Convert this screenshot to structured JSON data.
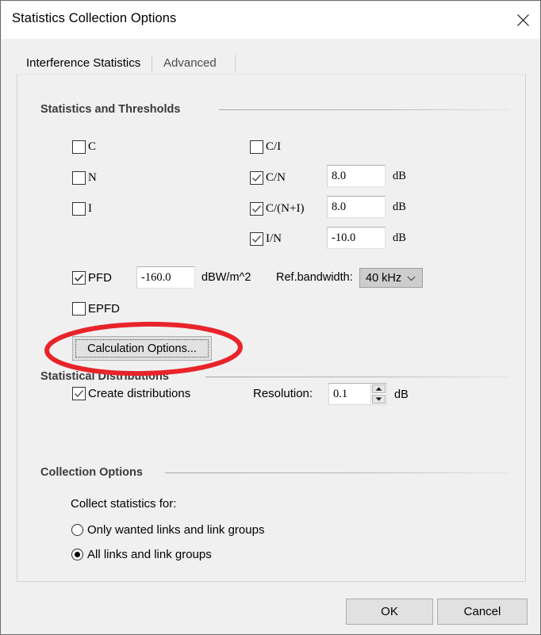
{
  "window": {
    "title": "Statistics Collection Options",
    "close_icon": "close-icon"
  },
  "tabs": [
    {
      "label": "Interference Statistics",
      "selected": true
    },
    {
      "label": "Advanced",
      "selected": false
    }
  ],
  "groups": {
    "thresholds": {
      "title": "Statistics and Thresholds"
    },
    "distributions": {
      "title": "Statistical Distributions"
    },
    "collection": {
      "title": "Collection Options"
    }
  },
  "checkboxes": {
    "c": {
      "label": "C",
      "checked": false
    },
    "n": {
      "label": "N",
      "checked": false
    },
    "i": {
      "label": "I",
      "checked": false
    },
    "ci": {
      "label": "C/I",
      "checked": false
    },
    "cn": {
      "label": "C/N",
      "checked": true
    },
    "cni": {
      "label": "C/(N+I)",
      "checked": true
    },
    "in": {
      "label": "I/N",
      "checked": true
    },
    "pfd": {
      "label": "PFD",
      "checked": true
    },
    "epfd": {
      "label": "EPFD",
      "checked": false
    },
    "create_distributions": {
      "label": "Create distributions",
      "checked": true
    }
  },
  "fields": {
    "cn_threshold": {
      "value": "8.0",
      "unit": "dB"
    },
    "cni_threshold": {
      "value": "8.0",
      "unit": "dB"
    },
    "in_threshold": {
      "value": "-10.0",
      "unit": "dB"
    },
    "pfd_threshold": {
      "value": "-160.0",
      "unit": "dBW/m^2"
    },
    "resolution": {
      "value": "0.1",
      "unit": "dB",
      "label": "Resolution:"
    }
  },
  "ref_bandwidth": {
    "label": "Ref.bandwidth:",
    "selected": "40 kHz",
    "chevron_icon": "chevron-down-icon"
  },
  "calculation_options_button": {
    "label": "Calculation Options..."
  },
  "collection": {
    "prompt": "Collect statistics for:",
    "options": [
      {
        "label": "Only wanted links and link groups",
        "selected": false
      },
      {
        "label": "All links and link groups",
        "selected": true
      }
    ]
  },
  "footer": {
    "ok": "OK",
    "cancel": "Cancel"
  },
  "annotation": {
    "shape": "red-oval-highlight",
    "color": "#e8242a",
    "target": "Calculation Options..."
  }
}
